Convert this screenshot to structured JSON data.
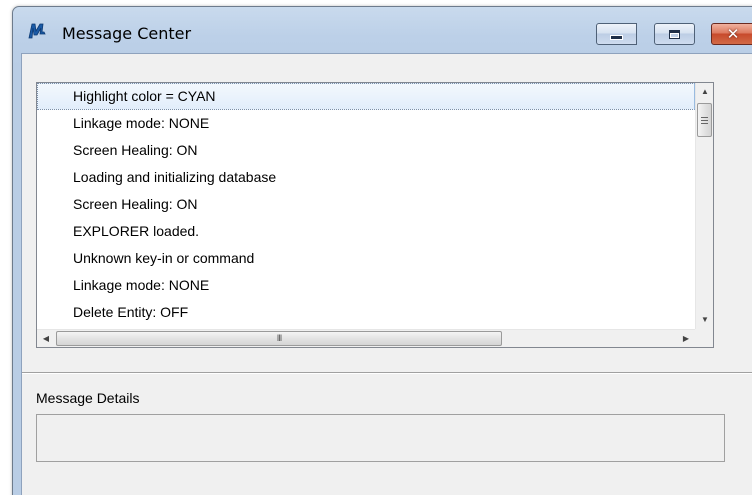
{
  "window": {
    "title": "Message Center",
    "app_icon": "microstation-icon",
    "controls": {
      "minimize_icon": "minimize-icon",
      "maximize_icon": "maximize-icon",
      "close_icon": "close-icon",
      "close_glyph": "✕"
    }
  },
  "messages": {
    "items": [
      "Highlight color = CYAN",
      "Linkage mode: NONE",
      "Screen Healing: ON",
      "Loading and initializing database",
      "Screen Healing: ON",
      "EXPLORER loaded.",
      "Unknown key-in or command",
      "Linkage mode: NONE",
      "Delete Entity: OFF"
    ],
    "selected_index": 0,
    "scroll": {
      "up_arrow": "▲",
      "down_arrow": "▼",
      "left_arrow": "◀",
      "right_arrow": "▶",
      "h_thumb_grip": "III"
    }
  },
  "details": {
    "label": "Message Details",
    "value": ""
  },
  "colors": {
    "selection_background": "#e2eefb",
    "selection_border": "#7b8fa8",
    "frame": "#b9cde5",
    "client": "#f0f0f0",
    "close_button": "#c74a2c"
  }
}
